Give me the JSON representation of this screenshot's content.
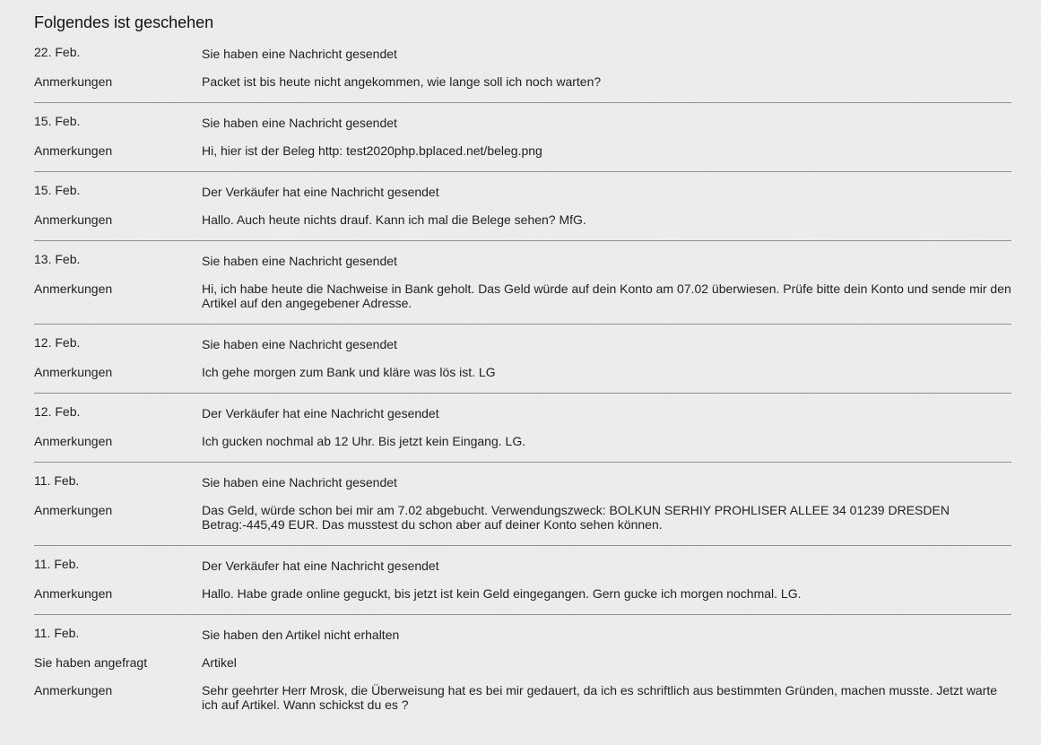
{
  "page": {
    "title": "Folgendes ist geschehen"
  },
  "entries": [
    {
      "date": "22. Feb.",
      "event": "Sie haben eine Nachricht gesendet",
      "rows": [
        {
          "label": "Anmerkungen",
          "value": "Packet ist bis heute nicht angekommen, wie lange soll ich noch warten?"
        }
      ]
    },
    {
      "date": "15. Feb.",
      "event": "Sie haben eine Nachricht gesendet",
      "rows": [
        {
          "label": "Anmerkungen",
          "value": "Hi, hier ist der Beleg http: test2020php.bplaced.net/beleg.png"
        }
      ]
    },
    {
      "date": "15. Feb.",
      "event": "Der Verkäufer hat eine Nachricht gesendet",
      "rows": [
        {
          "label": "Anmerkungen",
          "value": "Hallo. Auch heute nichts drauf. Kann ich mal die Belege sehen? MfG."
        }
      ]
    },
    {
      "date": "13. Feb.",
      "event": "Sie haben eine Nachricht gesendet",
      "rows": [
        {
          "label": "Anmerkungen",
          "value": "Hi, ich habe heute die Nachweise in Bank geholt. Das Geld würde auf dein Konto am 07.02 überwiesen. Prüfe bitte dein Konto und sende mir den\nArtikel auf den angegebener Adresse."
        }
      ]
    },
    {
      "date": "12. Feb.",
      "event": "Sie haben eine Nachricht gesendet",
      "rows": [
        {
          "label": "Anmerkungen",
          "value": "Ich gehe morgen zum Bank und kläre was lös ist. LG"
        }
      ]
    },
    {
      "date": "12. Feb.",
      "event": "Der Verkäufer hat eine Nachricht gesendet",
      "rows": [
        {
          "label": "Anmerkungen",
          "value": "Ich gucken nochmal ab 12 Uhr. Bis jetzt kein Eingang. LG."
        }
      ]
    },
    {
      "date": "11. Feb.",
      "event": "Sie haben eine Nachricht gesendet",
      "rows": [
        {
          "label": "Anmerkungen",
          "value": "Das Geld, würde schon bei mir am 7.02 abgebucht. Verwendungszweck: BOLKUN SERHIY PROHLISER ALLEE 34 01239 DRESDEN\nBetrag:-445,49 EUR. Das musstest du schon aber auf deiner Konto sehen können."
        }
      ]
    },
    {
      "date": "11. Feb.",
      "event": "Der Verkäufer hat eine Nachricht gesendet",
      "rows": [
        {
          "label": "Anmerkungen",
          "value": "Hallo. Habe grade online geguckt, bis jetzt ist kein Geld eingegangen. Gern gucke ich morgen nochmal. LG."
        }
      ]
    },
    {
      "date": "11. Feb.",
      "event": "Sie haben den Artikel nicht erhalten",
      "rows": [
        {
          "label": "Sie haben angefragt",
          "value": "Artikel"
        },
        {
          "label": "Anmerkungen",
          "value": "Sehr geehrter Herr Mrosk, die Überweisung hat es bei mir gedauert, da ich es schriftlich aus bestimmten Gründen, machen musste. Jetzt warte\nich auf Artikel. Wann schickst du es ?"
        }
      ]
    }
  ]
}
